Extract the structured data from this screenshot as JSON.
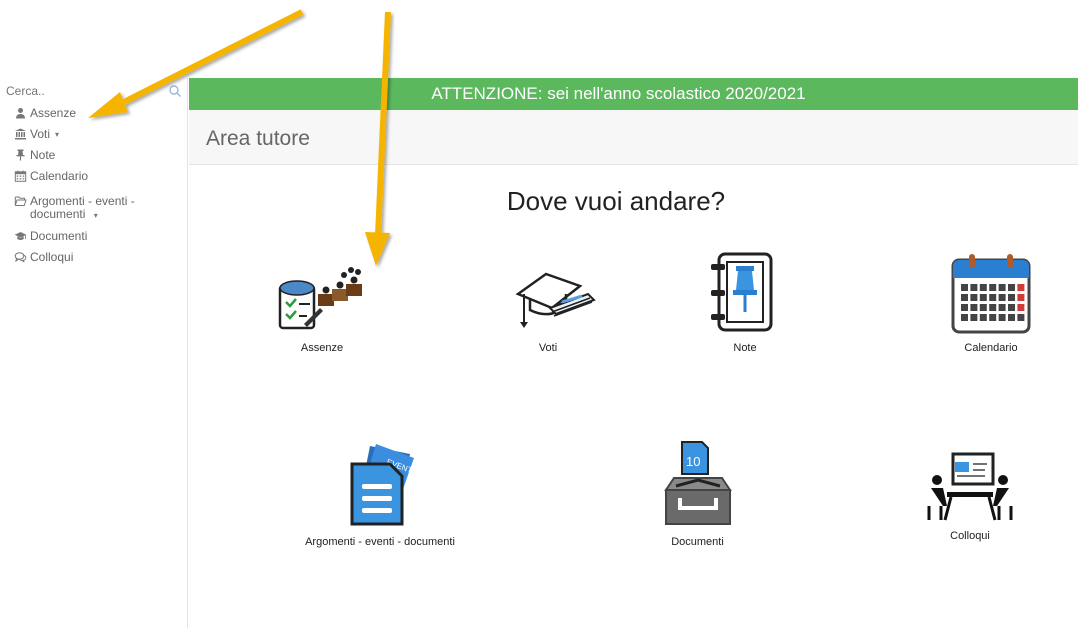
{
  "sidebar": {
    "search_placeholder": "Cerca..",
    "items": [
      {
        "label": "Assenze",
        "icon": "user-icon",
        "has_caret": false
      },
      {
        "label": "Voti",
        "icon": "bank-icon",
        "has_caret": true
      },
      {
        "label": "Note",
        "icon": "pin-icon",
        "has_caret": false
      },
      {
        "label": "Calendario",
        "icon": "calendar-icon",
        "has_caret": false
      },
      {
        "label": "Argomenti - eventi - documenti",
        "icon": "folder-open-icon",
        "has_caret": true
      },
      {
        "label": "Documenti",
        "icon": "graduation-cap-icon",
        "has_caret": false
      },
      {
        "label": "Colloqui",
        "icon": "comments-icon",
        "has_caret": false
      }
    ],
    "caret": "▾"
  },
  "banner": {
    "text": "ATTENZIONE: sei nell'anno scolastico 2020/2021",
    "color": "#5cb85c"
  },
  "page": {
    "title": "Area tutore",
    "heading": "Dove vuoi andare?"
  },
  "tiles": [
    {
      "label": "Assenze",
      "icon": "attendance-register-icon"
    },
    {
      "label": "Voti",
      "icon": "graduation-cap-diploma-icon"
    },
    {
      "label": "Note",
      "icon": "notebook-pin-icon"
    },
    {
      "label": "Calendario",
      "icon": "calendar-icon"
    },
    {
      "label": "Argomenti - eventi - documenti",
      "icon": "document-event-icon"
    },
    {
      "label": "Documenti",
      "icon": "archive-box-icon"
    },
    {
      "label": "Colloqui",
      "icon": "meeting-icon"
    }
  ],
  "annotation_color": "#f5b400"
}
